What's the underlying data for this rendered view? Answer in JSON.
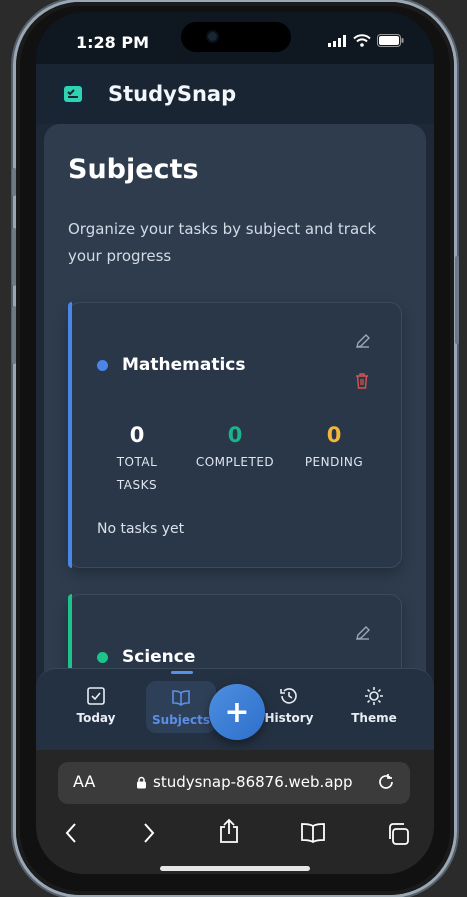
{
  "status": {
    "time": "1:28 PM"
  },
  "app": {
    "name": "StudySnap"
  },
  "page": {
    "title": "Subjects",
    "description": "Organize your tasks by subject and track your progress"
  },
  "subjects": [
    {
      "name": "Mathematics",
      "color": "#4a86e8",
      "total": "0",
      "total_label": "TOTAL TASKS",
      "completed": "0",
      "completed_label": "COMPLETED",
      "pending": "0",
      "pending_label": "PENDING",
      "empty": "No tasks yet"
    },
    {
      "name": "Science",
      "color": "#1ec28b"
    }
  ],
  "nav": {
    "today": "Today",
    "subjects": "Subjects",
    "add": "+",
    "history": "History",
    "theme": "Theme"
  },
  "browser": {
    "aa": "AA",
    "url": "studysnap-86876.web.app"
  },
  "colors": {
    "completed": "#19b48a",
    "pending": "#f3b63a",
    "accent": "#5b8fe6"
  }
}
